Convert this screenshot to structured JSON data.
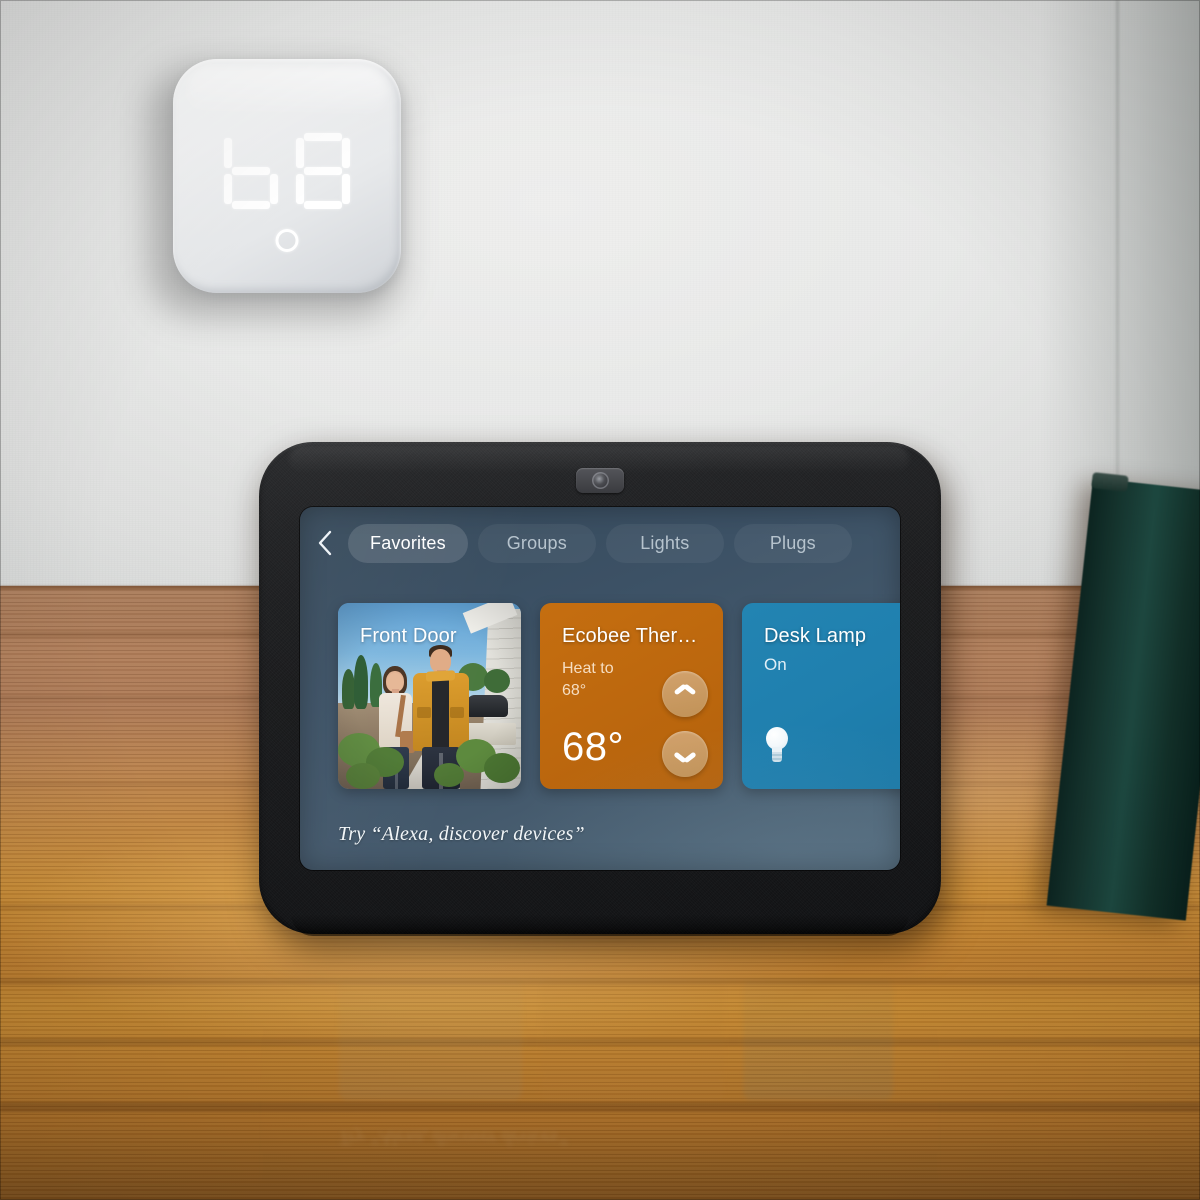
{
  "scene": {
    "wall_color": "#e9eae9",
    "desk_color": "#b9824f",
    "frame_color": "#1d4840"
  },
  "wall_thermostat": {
    "name": "wall-thermostat",
    "display_temperature": "68",
    "digits": [
      "6",
      "8"
    ],
    "body_color": "#eef0f2",
    "button": "power-button"
  },
  "device": {
    "name": "smart-display",
    "bezel_color": "#1b1c1e",
    "camera": "front-camera"
  },
  "screen": {
    "background_color": "#3c5165",
    "nav": {
      "back_icon": "back-chevron-icon",
      "tabs": [
        {
          "label": "Favorites",
          "active": true
        },
        {
          "label": "Groups",
          "active": false
        },
        {
          "label": "Lights",
          "active": false
        },
        {
          "label": "Plugs",
          "active": false
        }
      ]
    },
    "cards": [
      {
        "type": "camera",
        "title": "Front Door",
        "accent": "#5b93c7"
      },
      {
        "type": "thermostat",
        "title": "Ecobee Ther…",
        "mode_label": "Heat to",
        "target_temperature": "68°",
        "current_temperature": "68°",
        "increase_icon": "chevron-up-icon",
        "decrease_icon": "chevron-down-icon",
        "accent": "#bd680e"
      },
      {
        "type": "light",
        "title": "Desk Lamp",
        "state": "On",
        "icon": "lightbulb-icon",
        "accent": "#1f7fae"
      }
    ],
    "hint": "Try “Alexa, discover devices”"
  }
}
